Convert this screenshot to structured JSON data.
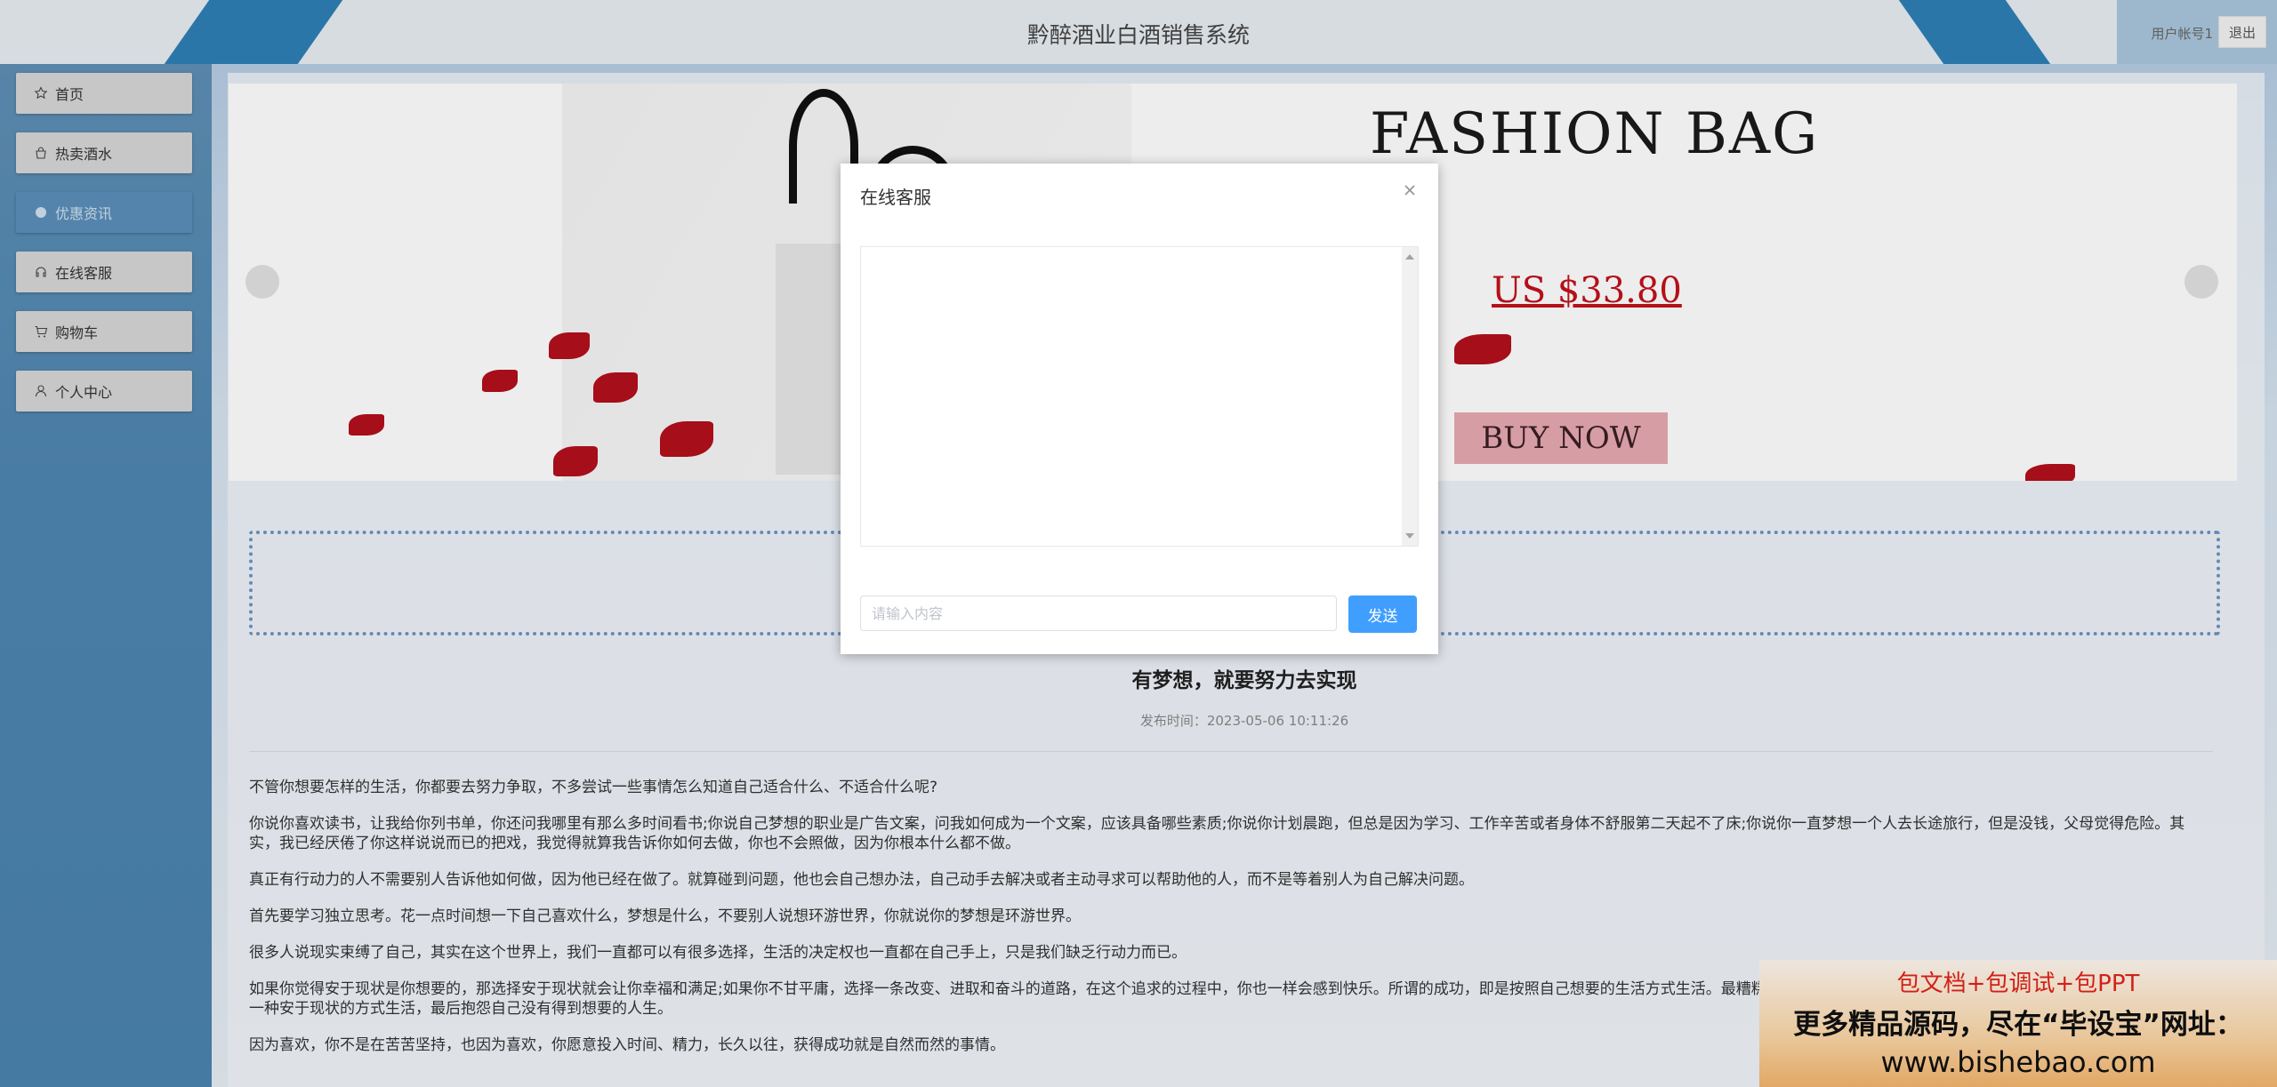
{
  "header": {
    "title": "黔醉酒业白酒销售系统",
    "user": "用户帐号1",
    "logout": "退出"
  },
  "sidebar": {
    "items": [
      {
        "label": "首页",
        "icon": "star-icon"
      },
      {
        "label": "热卖酒水",
        "icon": "bag-icon"
      },
      {
        "label": "优惠资讯",
        "icon": "circle-icon",
        "active": true
      },
      {
        "label": "在线客服",
        "icon": "headset-icon"
      },
      {
        "label": "购物车",
        "icon": "cart-icon"
      },
      {
        "label": "个人中心",
        "icon": "user-icon"
      }
    ]
  },
  "banner": {
    "heading": "FASHION BAG",
    "price": "US $33.80",
    "button": "BUY NOW"
  },
  "article": {
    "title": "有梦想，就要努力去实现",
    "time": "发布时间：2023-05-06 10:11:26",
    "paragraphs": [
      "不管你想要怎样的生活，你都要去努力争取，不多尝试一些事情怎么知道自己适合什么、不适合什么呢?",
      "你说你喜欢读书，让我给你列书单，你还问我哪里有那么多时间看书;你说自己梦想的职业是广告文案，问我如何成为一个文案，应该具备哪些素质;你说你计划晨跑，但总是因为学习、工作辛苦或者身体不舒服第二天起不了床;你说你一直梦想一个人去长途旅行，但是没钱，父母觉得危险。其实，我已经厌倦了你这样说说而已的把戏，我觉得就算我告诉你如何去做，你也不会照做，因为你根本什么都不做。",
      "真正有行动力的人不需要别人告诉他如何做，因为他已经在做了。就算碰到问题，他也会自己想办法，自己动手去解决或者主动寻求可以帮助他的人，而不是等着别人为自己解决问题。",
      "首先要学习独立思考。花一点时间想一下自己喜欢什么，梦想是什么，不要别人说想环游世界，你就说你的梦想是环游世界。",
      "很多人说现实束缚了自己，其实在这个世界上，我们一直都可以有很多选择，生活的决定权也一直都在自己手上，只是我们缺乏行动力而已。",
      "如果你觉得安于现状是你想要的，那选择安于现状就会让你幸福和满足;如果你不甘平庸，选择一条改变、进取和奋斗的道路，在这个追求的过程中，你也一样会感到快乐。所谓的成功，即是按照自己想要的生活方式生活。最糟糕的状态，莫过于你想要选择一条改变、进取和奋斗的道路时，却以一种安于现状的方式生活，最后抱怨自己没有得到想要的人生。",
      "因为喜欢，你不是在苦苦坚持，也因为喜欢，你愿意投入时间、精力，长久以往，获得成功就是自然而然的事情。"
    ]
  },
  "dialog": {
    "title": "在线客服",
    "input_placeholder": "请输入内容",
    "send": "发送"
  },
  "watermark": {
    "line1": "包文档+包调试+包PPT",
    "line2": "更多精品源码，尽在“毕设宝”网址：",
    "line3": "www.bishebao.com"
  }
}
